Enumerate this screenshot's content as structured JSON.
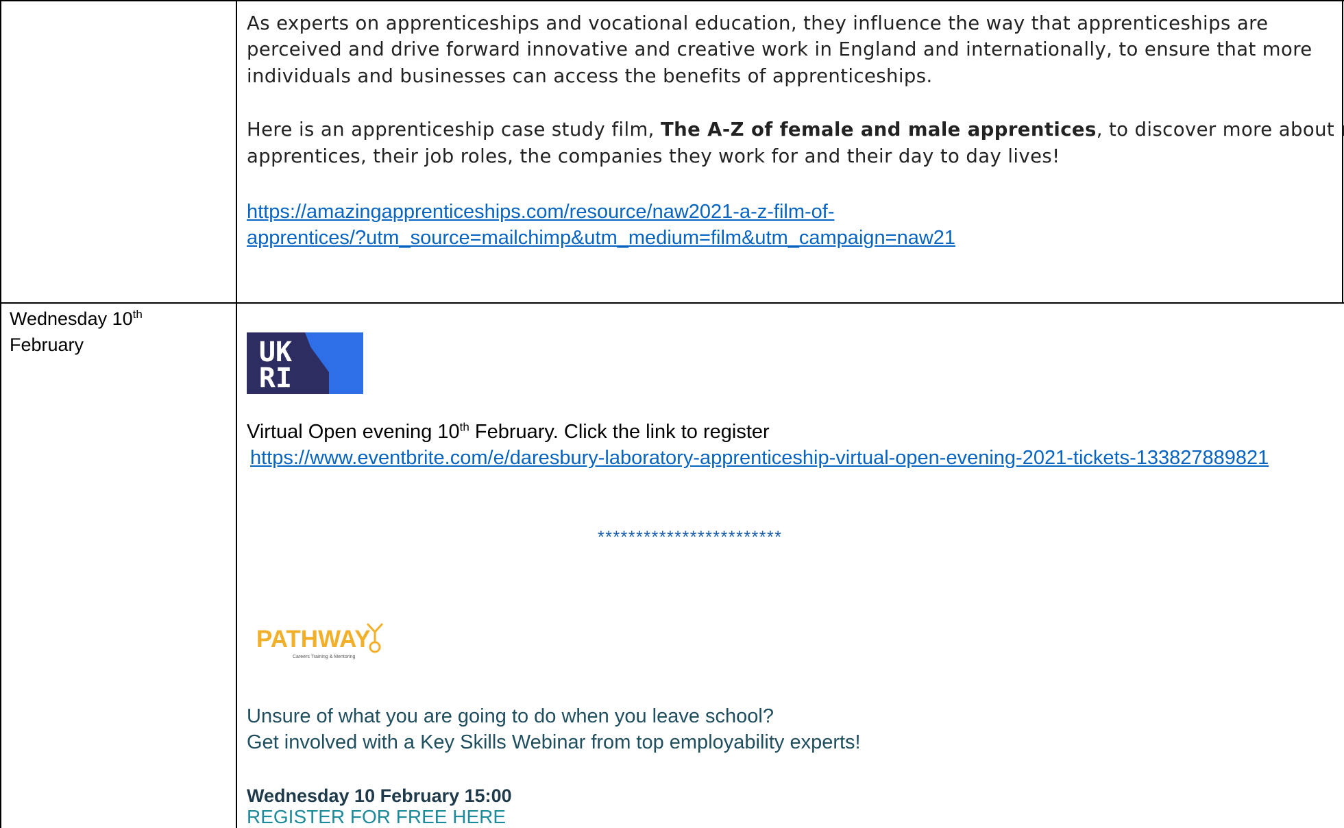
{
  "row1": {
    "para1": [
      "As experts on apprenticeships and vocational education, they influence the way that apprenticeships are",
      "perceived and drive forward innovative and creative work in England and internationally, to ensure that more",
      "individuals and businesses can access the benefits of apprenticeships."
    ],
    "para2_before": "Here is an apprenticeship case study film, ",
    "para2_bold": "The A-Z of female and male apprentices",
    "para2_after": ", to discover more about real",
    "para2_line2": "apprentices, their job roles, the companies they work for and their day to day lives!",
    "link_line1": "https://amazingapprenticeships.com/resource/naw2021-a-z-film-of-",
    "link_line2": "apprentices/?utm_source=mailchimp&utm_medium=film&utm_campaign=naw21"
  },
  "row2": {
    "date_prefix": "Wednesday 10",
    "date_sup": "th",
    "date_month": "February",
    "ukri_logo_text_top": "UK",
    "ukri_logo_text_bottom": "RI",
    "open_evening_prefix": "Virtual Open evening 10",
    "open_evening_sup": "th",
    "open_evening_suffix": " February. Click the link to register",
    "eventbrite_link": "https://www.eventbrite.com/e/daresbury-laboratory-apprenticeship-virtual-open-evening-2021-tickets-133827889821",
    "separator": "************************",
    "pathway_logo_text": "PATHWAY",
    "pathway_logo_tagline": "Careers Training & Mentoring",
    "unsure_line1": "Unsure of what you are going to do when you leave school?",
    "unsure_line2": "Get involved with a Key Skills Webinar from top employability experts!",
    "webinar_date": "Wednesday 10 February 15:00",
    "register_text": "REGISTER FOR FREE HERE"
  },
  "colors": {
    "link": "#0563c1",
    "ukri_dark": "#2e2d62",
    "ukri_blue": "#2e6fe8",
    "pathway_gold": "#f2b02a",
    "teal_text": "#1f4e5f",
    "register_teal": "#1d8a9c"
  }
}
